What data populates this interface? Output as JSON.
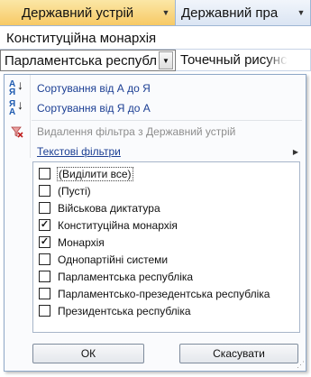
{
  "grid": {
    "headers": [
      {
        "label": "Державний устрій"
      },
      {
        "label": "Державний пра"
      }
    ],
    "row1": {
      "c1": "Конституційна монархія"
    },
    "row2": {
      "c1": "Парламентська республ",
      "c2": "Точечный рисунс"
    }
  },
  "menu": {
    "sort_asc": "Сортування від А до Я",
    "sort_desc": "Сортування від Я до А",
    "clear_filter": "Видалення фільтра з Державний устрій",
    "text_filters": "Текстові фільтри",
    "items": [
      {
        "label": "(Виділити все)",
        "checked": false
      },
      {
        "label": "(Пусті)",
        "checked": false
      },
      {
        "label": "Військова диктатура",
        "checked": false
      },
      {
        "label": "Конституційна монархія",
        "checked": true
      },
      {
        "label": "Монархія",
        "checked": true
      },
      {
        "label": "Однопартійні системи",
        "checked": false
      },
      {
        "label": "Парламентська республіка",
        "checked": false
      },
      {
        "label": "Парламентсько-презедентська республіка",
        "checked": false
      },
      {
        "label": "Президентська республіка",
        "checked": false
      }
    ],
    "ok_label": "ОК",
    "cancel_label": "Скасувати"
  },
  "colors": {
    "header_active": "#f7c965",
    "menu_text": "#1c3f94",
    "menu_border": "#8ea7c7"
  }
}
